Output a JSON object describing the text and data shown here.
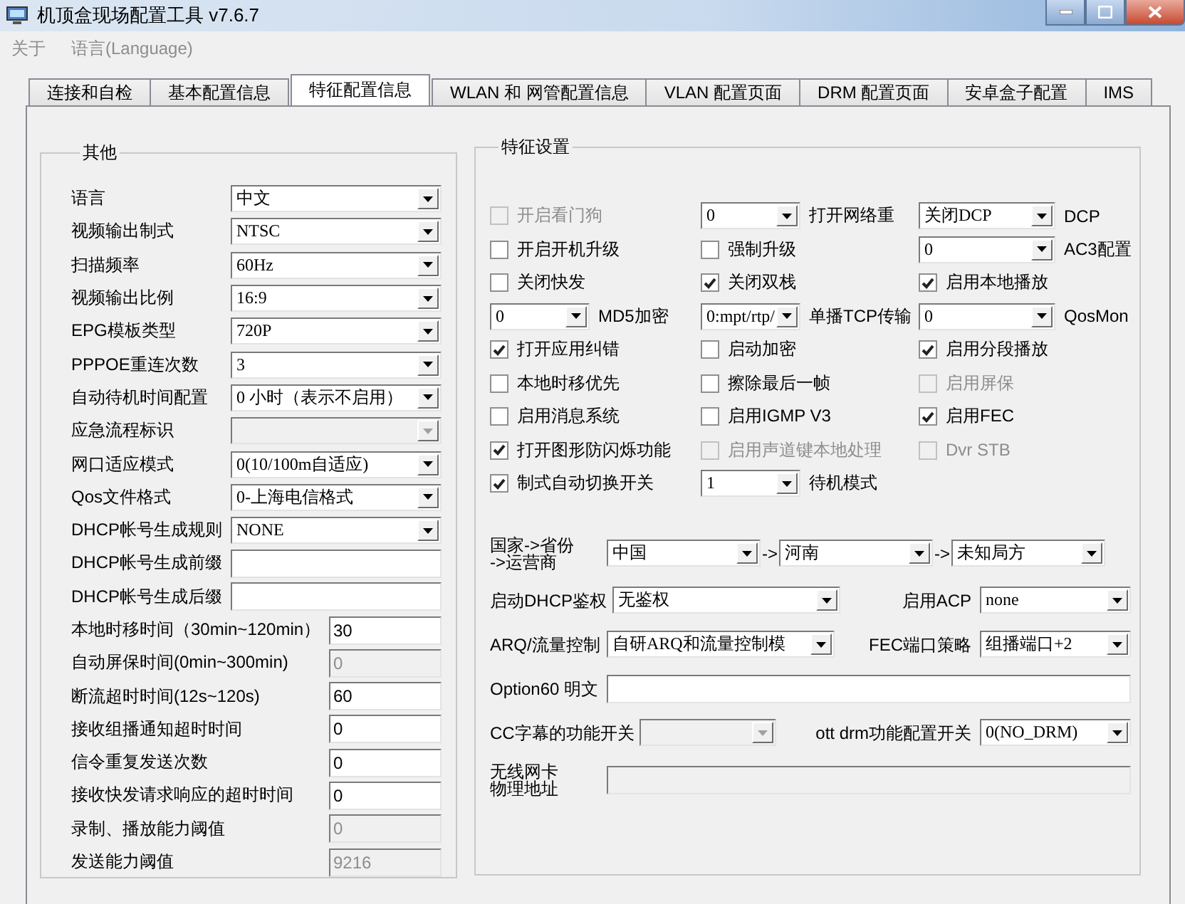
{
  "window": {
    "title": "机顶盒现场配置工具 v7.6.7"
  },
  "menu": [
    {
      "label": "关于",
      "disabled": true
    },
    {
      "label": "语言(Language)",
      "disabled": true
    }
  ],
  "tabs": [
    {
      "label": "连接和自检",
      "selected": false
    },
    {
      "label": "基本配置信息",
      "selected": false
    },
    {
      "label": "特征配置信息",
      "selected": true
    },
    {
      "label": "WLAN 和 网管配置信息",
      "selected": false
    },
    {
      "label": "VLAN 配置页面",
      "selected": false
    },
    {
      "label": "DRM 配置页面",
      "selected": false
    },
    {
      "label": "安卓盒子配置",
      "selected": false
    },
    {
      "label": "IMS",
      "selected": false
    }
  ],
  "other_group": {
    "title": "其他",
    "rows": [
      {
        "label": "语言",
        "kind": "dropdown",
        "value": "中文",
        "disabled": false
      },
      {
        "label": "视频输出制式",
        "kind": "dropdown",
        "value": "NTSC",
        "disabled": false
      },
      {
        "label": "扫描频率",
        "kind": "dropdown",
        "value": "60Hz",
        "disabled": false
      },
      {
        "label": "视频输出比例",
        "kind": "dropdown",
        "value": "16:9",
        "disabled": false
      },
      {
        "label": "EPG模板类型",
        "kind": "dropdown",
        "value": "720P",
        "disabled": false
      },
      {
        "label": "PPPOE重连次数",
        "kind": "dropdown",
        "value": "3",
        "disabled": false
      },
      {
        "label": "自动待机时间配置",
        "kind": "dropdown",
        "value": "0 小时（表示不启用）",
        "disabled": false
      },
      {
        "label": "应急流程标识",
        "kind": "dropdown",
        "disabled": true
      },
      {
        "label": "网口适应模式",
        "kind": "dropdown",
        "value": "0(10/100m自适应)",
        "disabled": false
      },
      {
        "label": "Qos文件格式",
        "kind": "dropdown",
        "value": "0-上海电信格式",
        "disabled": false
      },
      {
        "label": "DHCP帐号生成规则",
        "kind": "dropdown",
        "value": "NONE",
        "disabled": false
      },
      {
        "label": "DHCP帐号生成前缀",
        "kind": "field",
        "disabled": false
      },
      {
        "label": "DHCP帐号生成后缀",
        "kind": "field",
        "disabled": false
      },
      {
        "label": "本地时移时间（30min~120min）",
        "kind": "short-field",
        "value": "30",
        "disabled": false
      },
      {
        "label": "自动屏保时间(0min~300min)",
        "kind": "short-field",
        "value": "0",
        "disabled": true
      },
      {
        "label": "断流超时时间(12s~120s)",
        "kind": "short-field",
        "value": "60",
        "disabled": false
      },
      {
        "label": "接收组播通知超时时间",
        "kind": "short-field",
        "value": "0",
        "disabled": false
      },
      {
        "label": "信令重复发送次数",
        "kind": "short-field",
        "value": "0",
        "disabled": false
      },
      {
        "label": "接收快发请求响应的超时时间",
        "kind": "short-field",
        "value": "0",
        "disabled": false
      },
      {
        "label": "录制、播放能力阈值",
        "kind": "short-field",
        "value": "0",
        "disabled": true
      },
      {
        "label": "发送能力阈值",
        "kind": "short-field",
        "value": "9216",
        "disabled": true
      }
    ]
  },
  "feature_group": {
    "title": "特征设置",
    "grid": [
      [
        {
          "kind": "checkbox",
          "label": "开启看门狗",
          "checked": false,
          "disabled": true
        },
        {
          "kind": "dropdown",
          "value": "0",
          "caption": "打开网络重"
        },
        {
          "kind": "dropdown",
          "value": "关闭DCP",
          "caption": "DCP"
        }
      ],
      [
        {
          "kind": "checkbox",
          "label": "开启开机升级",
          "checked": false,
          "disabled": false
        },
        {
          "kind": "checkbox",
          "label": "强制升级",
          "checked": false,
          "disabled": false
        },
        {
          "kind": "dropdown",
          "value": "0",
          "caption": "AC3配置"
        }
      ],
      [
        {
          "kind": "checkbox",
          "label": "关闭快发",
          "checked": false,
          "disabled": false
        },
        {
          "kind": "checkbox",
          "label": "关闭双栈",
          "checked": true,
          "disabled": false
        },
        {
          "kind": "checkbox",
          "label": "启用本地播放",
          "checked": true,
          "disabled": false
        }
      ],
      [
        {
          "kind": "dropdown",
          "value": "0",
          "caption": "MD5加密"
        },
        {
          "kind": "dropdown",
          "value": "0:mpt/rtp/",
          "caption": "单播TCP传输"
        },
        {
          "kind": "dropdown",
          "value": "0",
          "caption": "QosMon"
        }
      ],
      [
        {
          "kind": "checkbox",
          "label": "打开应用纠错",
          "checked": true,
          "disabled": false
        },
        {
          "kind": "checkbox",
          "label": "启动加密",
          "checked": false,
          "disabled": false
        },
        {
          "kind": "checkbox",
          "label": "启用分段播放",
          "checked": true,
          "disabled": false
        }
      ],
      [
        {
          "kind": "checkbox",
          "label": "本地时移优先",
          "checked": false,
          "disabled": false
        },
        {
          "kind": "checkbox",
          "label": "擦除最后一帧",
          "checked": false,
          "disabled": false
        },
        {
          "kind": "checkbox",
          "label": "启用屏保",
          "checked": false,
          "disabled": true
        }
      ],
      [
        {
          "kind": "checkbox",
          "label": "启用消息系统",
          "checked": false,
          "disabled": false
        },
        {
          "kind": "checkbox",
          "label": "启用IGMP V3",
          "checked": false,
          "disabled": false
        },
        {
          "kind": "checkbox",
          "label": "启用FEC",
          "checked": true,
          "disabled": false
        }
      ],
      [
        {
          "kind": "checkbox",
          "label": "打开图形防闪烁功能",
          "checked": true,
          "disabled": false
        },
        {
          "kind": "checkbox",
          "label": "启用声道键本地处理",
          "checked": false,
          "disabled": true
        },
        {
          "kind": "checkbox",
          "label": "Dvr STB",
          "checked": false,
          "disabled": true
        }
      ],
      [
        {
          "kind": "checkbox",
          "label": "制式自动切换开关",
          "checked": true,
          "disabled": false
        },
        {
          "kind": "dropdown",
          "value": "1",
          "caption": "待机模式"
        }
      ]
    ],
    "rows": [
      [
        {
          "kind": "chain",
          "label": "国家->省份\n->运营商",
          "dropdowns": [
            {
              "value": "中国"
            },
            {
              "separator": "->",
              "value": "河南"
            },
            {
              "separator": "->",
              "value": "未知局方"
            }
          ]
        }
      ],
      [
        {
          "kind": "dropdown",
          "label": "启动DHCP鉴权",
          "value": "无鉴权",
          "disabled": false
        },
        {
          "kind": "dropdown",
          "label": "启用ACP",
          "value": "none",
          "disabled": false
        }
      ],
      [
        {
          "kind": "dropdown",
          "label": "ARQ/流量控制",
          "value": "自研ARQ和流量控制模",
          "disabled": false
        },
        {
          "kind": "dropdown",
          "label": "FEC端口策略",
          "value": "组播端口+2",
          "disabled": false
        }
      ],
      [
        {
          "kind": "field",
          "label": "Option60 明文",
          "disabled": false
        }
      ],
      [
        {
          "kind": "dropdown",
          "label": "CC字幕的功能开关",
          "disabled": true
        },
        {
          "kind": "dropdown",
          "label": "ott drm功能配置开关",
          "value": "0(NO_DRM)",
          "disabled": false
        }
      ],
      [
        {
          "kind": "field",
          "label": "无线网卡物理地址",
          "disabled": true
        }
      ]
    ]
  }
}
